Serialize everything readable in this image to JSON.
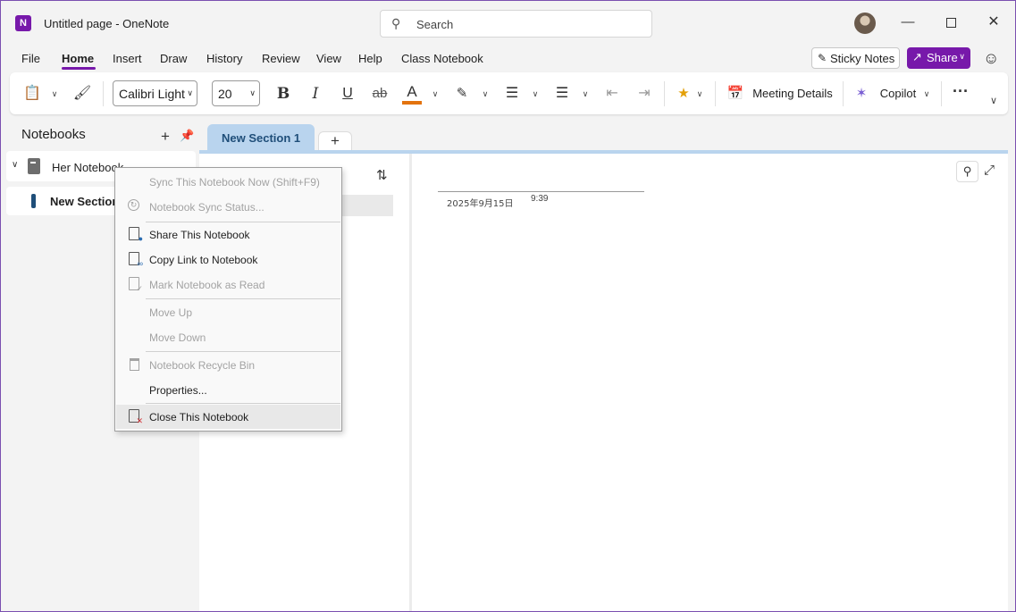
{
  "titlebar": {
    "app_icon_letter": "N",
    "title": "Untitled page  -  OneNote",
    "search_placeholder": "Search"
  },
  "menubar": {
    "items": [
      "File",
      "Home",
      "Insert",
      "Draw",
      "History",
      "Review",
      "View",
      "Help",
      "Class Notebook"
    ],
    "active": "Home",
    "sticky_notes": "Sticky Notes",
    "share": "Share"
  },
  "ribbon": {
    "font_name": "Calibri Light",
    "font_size": "20",
    "bold": "B",
    "italic": "I",
    "underline": "U",
    "strikethrough": "ab",
    "font_color_letter": "A",
    "font_color": "#e3730e",
    "meeting_details": "Meeting Details",
    "copilot": "Copilot",
    "more": "···"
  },
  "sidebar": {
    "header": "Notebooks",
    "notebook_name": "Her Notebook",
    "section_name": "New Section"
  },
  "sections": {
    "active_tab": "New Section 1",
    "add_tab": "+",
    "tab_color": "#b9d4ee"
  },
  "page": {
    "date": "2025年9月15日",
    "time": "9:39"
  },
  "context_menu": {
    "sync_now": "Sync This Notebook Now  (Shift+F9)",
    "sync_status": "Notebook Sync Status...",
    "share": "Share This Notebook",
    "copy_link": "Copy Link to Notebook",
    "mark_read": "Mark Notebook as Read",
    "move_up": "Move Up",
    "move_down": "Move Down",
    "recycle_bin": "Notebook Recycle Bin",
    "properties": "Properties...",
    "close": "Close This Notebook"
  },
  "colors": {
    "accent": "#7719aa",
    "section_bar": "#1f4e79"
  }
}
